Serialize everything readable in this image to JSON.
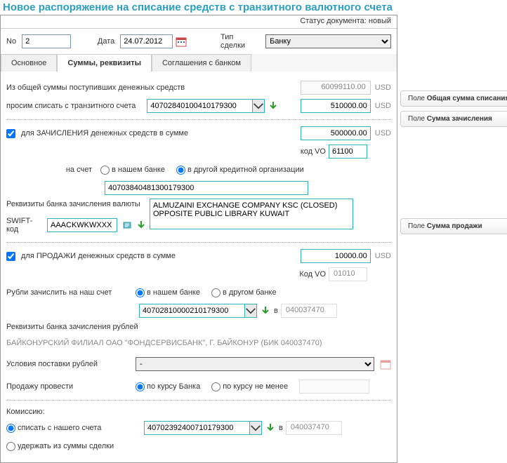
{
  "title": "Новое распоряжение на списание средств с транзитного валютного счета",
  "status_label": "Статус документа:",
  "status_value": "новый",
  "top": {
    "no_label": "No",
    "no_value": "2",
    "date_label": "Дата",
    "date_value": "24.07.2012",
    "deal_label": "Тип сделки",
    "deal_value": "Банку"
  },
  "tabs": {
    "t0": "Основное",
    "t1": "Суммы, реквизиты",
    "t2": "Соглашения с банком"
  },
  "s1": {
    "line1": "Из общей суммы поступивших денежных средств",
    "total": "60099110.00",
    "cur": "USD",
    "line2": "просим списать с транзитного счета",
    "acct": "40702840100410179300",
    "amount": "510000.00"
  },
  "s2": {
    "chk": "для ЗАЧИСЛЕНИЯ денежных средств в сумме",
    "amount": "500000.00",
    "cur": "USD",
    "vo_label": "код VO",
    "vo": "61100",
    "acct_label": "на счет",
    "r1": "в нашем банке",
    "r2": "в другой кредитной организации",
    "acct": "40703840481300179300",
    "bank_label": "Реквизиты банка зачисления валюты",
    "bank_text": "ALMUZAINI EXCHANGE COMPANY KSC (CLOSED) OPPOSITE PUBLIC LIBRARY KUWAIT",
    "swift_label": "SWIFT-код",
    "swift": "AAACKWKWXXX"
  },
  "s3": {
    "chk": "для ПРОДАЖИ денежных средств в сумме",
    "amount": "10000.00",
    "cur": "USD",
    "vo_label": "Код VO",
    "vo": "01010",
    "rub_label": "Рубли зачислить на наш счет",
    "r1": "в нашем банке",
    "r2": "в другом банке",
    "acct": "40702810000210179300",
    "in_label": "в",
    "bic": "040037470",
    "bank_label": "Реквизиты банка зачисления рублей",
    "bank_text": "БАЙКОНУРСКИЙ ФИЛИАЛ ОАО \"ФОНДСЕРВИСБАНК\", Г. БАЙКОНУР (БИК 040037470)",
    "cond_label": "Условия поставки рублей",
    "cond_value": "-",
    "sale_label": "Продажу провести",
    "sr1": "по курсу Банка",
    "sr2": "по курсу не менее"
  },
  "s4": {
    "heading": "Комиссию:",
    "r1": "списать с нашего счета",
    "r2": "удержать из суммы сделки",
    "acct": "40702392400710179300",
    "in_label": "в",
    "bic": "040037470"
  },
  "tips": {
    "t1a": "Поле ",
    "t1b": "Общая сумма списания",
    "t2a": "Поле ",
    "t2b": "Сумма зачисления",
    "t3a": "Поле ",
    "t3b": "Сумма продажи"
  }
}
